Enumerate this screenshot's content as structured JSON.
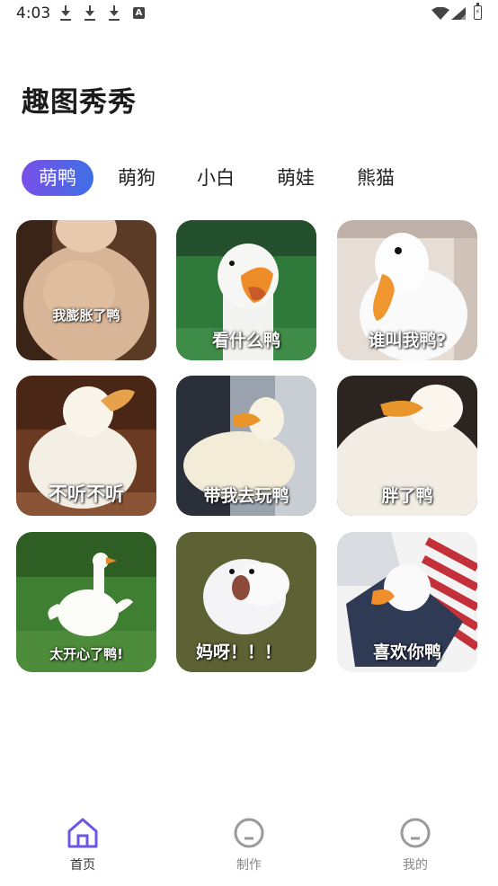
{
  "status_bar": {
    "time": "4:03",
    "icons": [
      "download-icon",
      "download-icon",
      "download-icon",
      "a-notification-icon",
      "wifi-icon",
      "signal-icon",
      "battery-icon"
    ]
  },
  "app": {
    "title": "趣图秀秀"
  },
  "tabs": [
    {
      "label": "萌鸭",
      "active": true
    },
    {
      "label": "萌狗",
      "active": false
    },
    {
      "label": "小白",
      "active": false
    },
    {
      "label": "萌娃",
      "active": false
    },
    {
      "label": "熊猫",
      "active": false
    }
  ],
  "memes": [
    {
      "caption": "我膨胀了鸭"
    },
    {
      "caption": "看什么鸭"
    },
    {
      "caption": "谁叫我鸭?"
    },
    {
      "caption": "不听不听"
    },
    {
      "caption": "带我去玩鸭"
    },
    {
      "caption": "胖了鸭"
    },
    {
      "caption": "太开心了鸭!"
    },
    {
      "caption": "妈呀！！！"
    },
    {
      "caption": "喜欢你鸭"
    }
  ],
  "bottom_nav": [
    {
      "label": "首页",
      "icon": "home-icon",
      "active": true
    },
    {
      "label": "制作",
      "icon": "face-icon",
      "active": false
    },
    {
      "label": "我的",
      "icon": "face-icon",
      "active": false
    }
  ],
  "colors": {
    "accent_start": "#7b50e8",
    "accent_end": "#3f6fe6",
    "nav_active": "#6b57e6",
    "nav_inactive": "#9a9a9a"
  }
}
